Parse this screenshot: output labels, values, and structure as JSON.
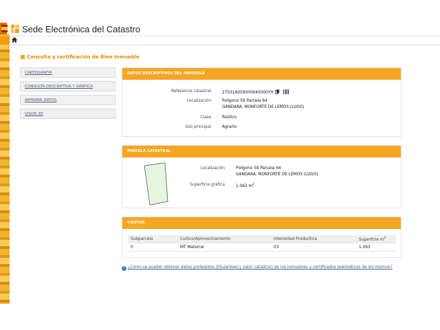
{
  "header": {
    "title": "Sede Electrónica del Catastro"
  },
  "page": {
    "title": "Consulta y certificación de Bien Inmueble"
  },
  "menu": [
    {
      "label": "CARTOGRAFÍA"
    },
    {
      "label": "CONSULTA DESCRIPTIVA Y GRÁFICA"
    },
    {
      "label": "IMPRIMIR DATOS"
    },
    {
      "label": "VISOR 3D"
    }
  ],
  "datos": {
    "header": "DATOS DESCRIPTIVOS DEL INMUEBLE",
    "ref_label": "Referencia catastral",
    "ref_value": "27031A059000640000YH",
    "loc_label": "Localización",
    "loc_value_1": "Polígono 59 Parcela 64",
    "loc_value_2": "GANDARA. MONFORTE DE LEMOS (LUGO)",
    "clase_label": "Clase",
    "clase_value": "Rústico",
    "uso_label": "Uso principal",
    "uso_value": "Agrario"
  },
  "parcela": {
    "header": "PARCELA CATASTRAL",
    "loc_label": "Localización",
    "loc_value_1": "Polígono 59 Parcela 64",
    "loc_value_2": "GANDARA. MONFORTE DE LEMOS (LUGO)",
    "sup_label": "Superficie gráfica",
    "sup_value": "1.063 m",
    "sup_unit_sup": "2"
  },
  "cultivo": {
    "header": "CULTIVO",
    "columns": [
      "Subparcela",
      "Cultivo/Aprovechamiento",
      "Intensidad Productiva",
      "Superficie m"
    ],
    "col_unit_sup": "2",
    "row": [
      "0",
      "MT Matorral",
      "03",
      "1.063"
    ]
  },
  "help": {
    "text": "¿Cómo se pueder obtener datos protegidos (titularidad y valor catastral) de los inmuebles y certificados telemáticos de los mismos?"
  },
  "colors": {
    "accent": "#f5a623",
    "title": "#e38b00",
    "parcel_fill": "#e6f5e0"
  }
}
